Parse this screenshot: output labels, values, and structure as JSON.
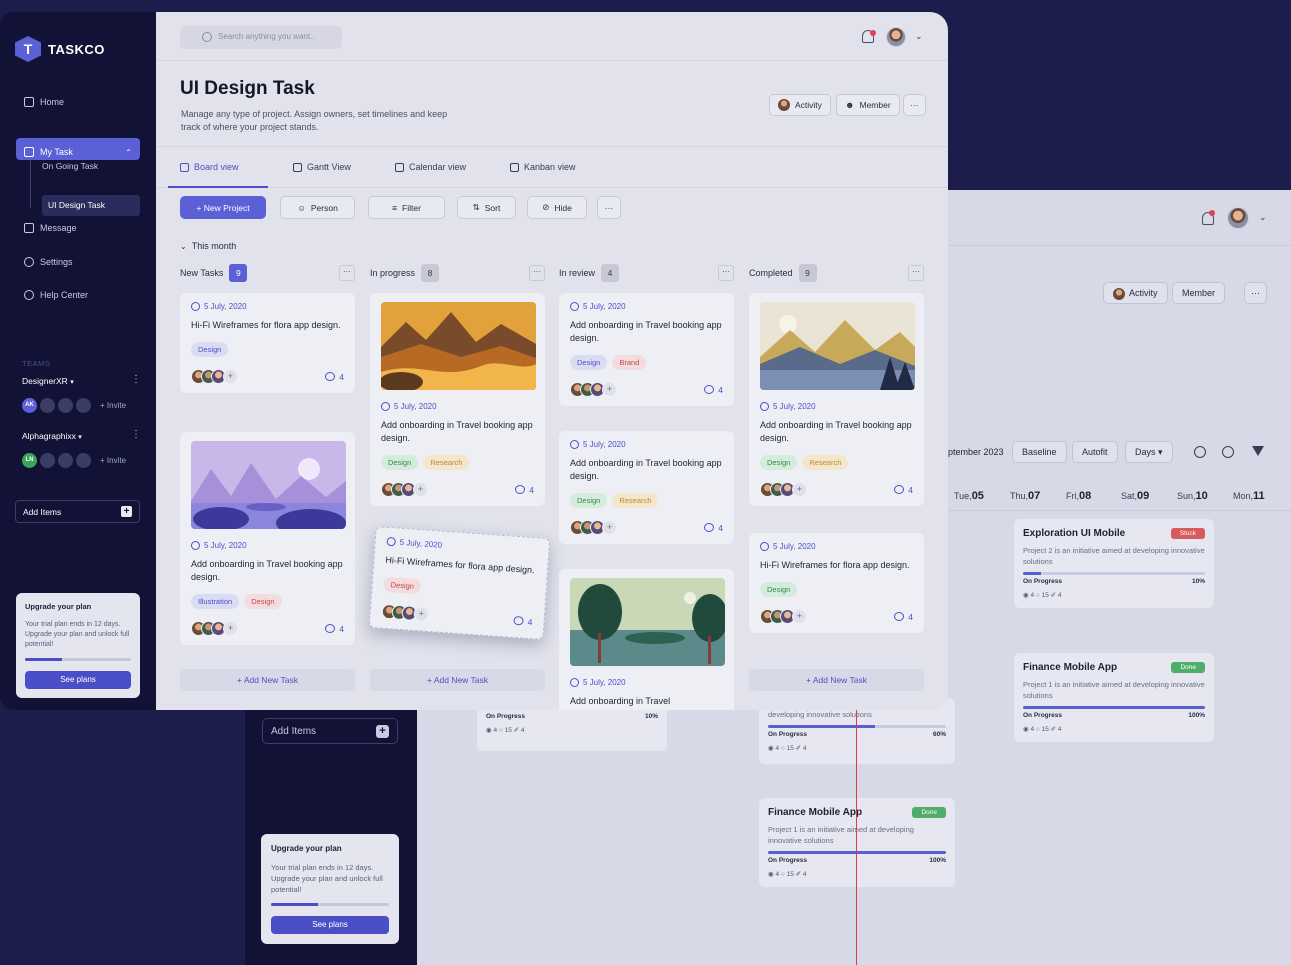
{
  "app": {
    "name": "TASKCO"
  },
  "sidebar": {
    "nav": [
      {
        "label": "Home",
        "icon": "home-icon"
      },
      {
        "label": "My Task",
        "icon": "task-icon"
      },
      {
        "label": "Message",
        "icon": "message-icon"
      },
      {
        "label": "Settings",
        "icon": "settings-icon"
      },
      {
        "label": "Help Center",
        "icon": "help-icon"
      }
    ],
    "subnav": [
      "On Going Task",
      "UI Design Task"
    ],
    "teams_label": "TEAMS",
    "teams": [
      {
        "name": "DesignerXR",
        "initials": "AK",
        "initials_color": "#5c60d6",
        "invite": "+ Invite"
      },
      {
        "name": "Alphagraphixx",
        "initials": "LN",
        "initials_color": "#3aa55a",
        "invite": "+ Invite"
      }
    ],
    "add_items": "Add Items",
    "upgrade": {
      "title": "Upgrade your plan",
      "text": "Your trial plan ends in 12 days. Upgrade your plan and unlock full potential!",
      "progress": 0.35,
      "button": "See plans"
    }
  },
  "header": {
    "search_placeholder": "Search anything you want..",
    "title": "UI Design Task",
    "description": "Manage any type of project. Assign owners, set timelines and keep track of where your project stands.",
    "buttons": {
      "activity": "Activity",
      "member": "Member",
      "more": "···"
    }
  },
  "tabs": [
    {
      "label": "Board view",
      "active": true
    },
    {
      "label": "Gantt View",
      "active": false
    },
    {
      "label": "Calendar view",
      "active": false
    },
    {
      "label": "Kanban view",
      "active": false
    }
  ],
  "toolbar": {
    "new_project": "+ New Project",
    "person": "Person",
    "filter": "Filter",
    "sort": "Sort",
    "hide": "Hide",
    "more": "···"
  },
  "month_label": "This month",
  "columns": [
    {
      "name": "New Tasks",
      "count": "9"
    },
    {
      "name": "In progress",
      "count": "8"
    },
    {
      "name": "In review",
      "count": "4"
    },
    {
      "name": "Completed",
      "count": "9"
    }
  ],
  "cards": {
    "c1": {
      "date": "5 July, 2020",
      "title": "Hi-Fi Wireframes for flora app design.",
      "tags": [
        "Design"
      ],
      "comments": "4"
    },
    "c2": {
      "date": "5 July, 2020",
      "title": "Add onboarding in Travel booking app design.",
      "tags": [
        "Illustration",
        "Design"
      ],
      "comments": "4"
    },
    "c3": {
      "date": "5 July, 2020",
      "title": "Add onboarding in Travel booking app design.",
      "tags": [
        "Design",
        "Research"
      ],
      "comments": "4"
    },
    "c4": {
      "date": "5 July, 2020",
      "title": "Hi-Fi Wireframes for flora app design.",
      "tags": [
        "Design"
      ],
      "comments": "4"
    },
    "c5": {
      "date": "5 July, 2020",
      "title": "Add onboarding in Travel booking app design.",
      "tags": [
        "Design",
        "Brand"
      ],
      "comments": "4"
    },
    "c6": {
      "date": "5 July, 2020",
      "title": "Add onboarding in Travel booking app design.",
      "tags": [
        "Design",
        "Research"
      ],
      "comments": "4"
    },
    "c7": {
      "date": "5 July, 2020",
      "title": "Add onboarding in Travel"
    },
    "c8": {
      "date": "5 July, 2020",
      "title": "Add onboarding in Travel booking app design.",
      "tags": [
        "Design",
        "Research"
      ],
      "comments": "4"
    },
    "c9": {
      "date": "5 July, 2020",
      "title": "Hi-Fi Wireframes for flora app design.",
      "tags": [
        "Design"
      ],
      "comments": "4"
    }
  },
  "add_new_task": "+ Add New Task",
  "gantt": {
    "month": "ptember 2023",
    "buttons": {
      "baseline": "Baseline",
      "autofit": "Autofit",
      "days": "Days"
    },
    "days": [
      {
        "dow": "Tue,",
        "d": "05"
      },
      {
        "dow": "Thu,",
        "d": "07"
      },
      {
        "dow": "Fri,",
        "d": "08"
      },
      {
        "dow": "Sat,",
        "d": "09"
      },
      {
        "dow": "Sun,",
        "d": "10"
      },
      {
        "dow": "Mon,",
        "d": "11"
      }
    ],
    "cards": [
      {
        "title": "Exploration UI Mobile",
        "badge": "Stuck",
        "badge_color": "#d85a5a",
        "desc": "Project 2 is an initiative aimed at developing innovative solutions",
        "status": "On Progress",
        "pct_label": "10%",
        "progress": 0.1,
        "meta": "◉ 4   ○ 15   ✐ 4"
      },
      {
        "title": "Finance Mobile App",
        "badge": "Done",
        "badge_color": "#4fae6a",
        "desc": "Project 1 is an initiative aimed at developing innovative solutions",
        "status": "On Progress",
        "pct_label": "100%",
        "progress": 1.0,
        "meta": "◉ 4   ○ 15   ✐ 4"
      },
      {
        "title": "Finance Mobile App",
        "badge": "Done",
        "badge_color": "#4fae6a",
        "desc": "Project 1 is an initiative aimed at developing innovative solutions",
        "status": "On Progress",
        "pct_label": "100%",
        "progress": 1.0,
        "meta": "◉ 4   ○ 15   ✐ 4"
      }
    ],
    "partial": [
      {
        "desc": "developing innovative solutions",
        "status": "On Progress",
        "pct_label": "60%",
        "progress": 0.6,
        "meta": "◉ 4   ○ 15   ✐ 4"
      },
      {
        "status": "On Progress",
        "pct_label": "10%",
        "progress": 0.1,
        "meta": "◉ 4   ○ 15   ✐ 4"
      }
    ],
    "activity": "Activity",
    "member": "Member",
    "more": "···"
  },
  "bg_sidebar": {
    "add_items": "Add Items",
    "upgrade": {
      "title": "Upgrade your plan",
      "text": "Your trial plan ends in 12 days. Upgrade your plan and unlock full potential!",
      "progress": 0.4,
      "button": "See plans"
    }
  }
}
